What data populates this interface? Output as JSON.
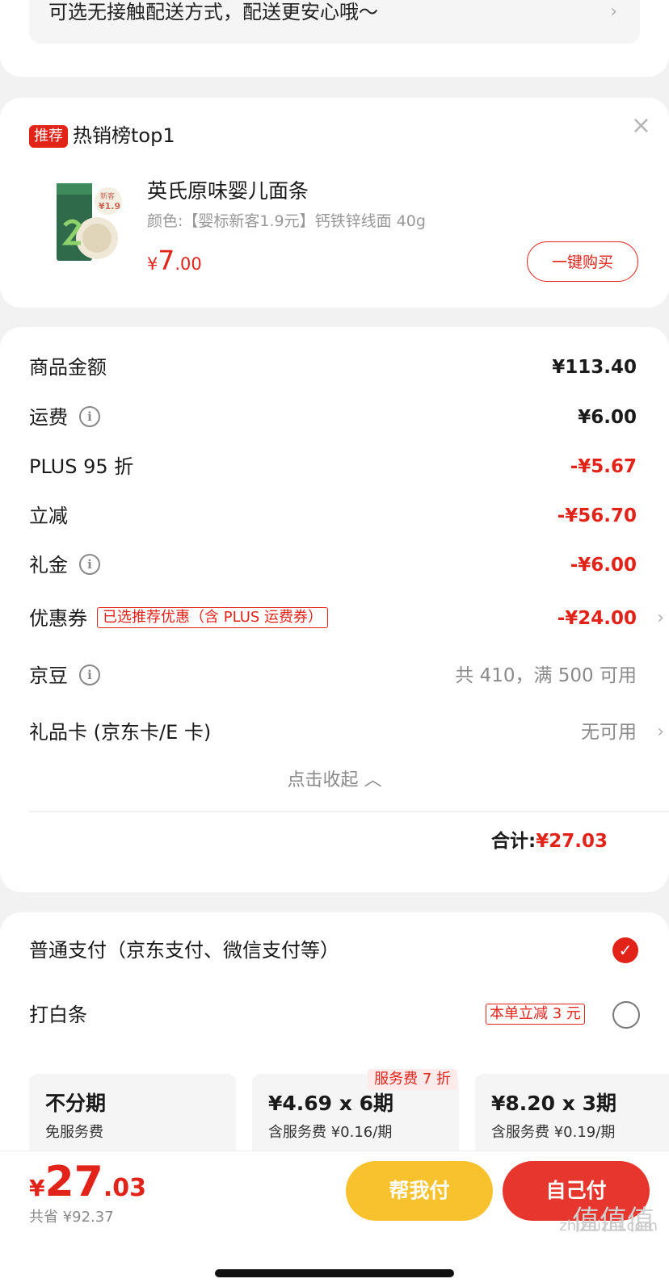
{
  "delivery": {
    "text": "可选无接触配送方式，配送更安心哦～",
    "chevron": "chevron-right"
  },
  "recommend": {
    "badge": "推荐",
    "title": "热销榜top1",
    "product": {
      "name": "英氏原味婴儿面条",
      "spec": "颜色:【婴标新客1.9元】钙铁锌线面 40g",
      "price_currency": "¥",
      "price_int": "7",
      "price_dec": ".00",
      "buy_label": "一键购买",
      "img_badge_top": "新客",
      "img_badge_price": "¥1.9"
    }
  },
  "fees": {
    "goods": {
      "label": "商品金额",
      "value": "¥113.40"
    },
    "shipping": {
      "label": "运费",
      "value": "¥6.00"
    },
    "plus": {
      "label": "PLUS 95 折",
      "value": "-¥5.67"
    },
    "discount": {
      "label": "立减",
      "value": "-¥56.70"
    },
    "gift_money": {
      "label": "礼金",
      "value": "-¥6.00"
    },
    "coupon": {
      "label": "优惠券",
      "tag": "已选推荐优惠（含 PLUS 运费券）",
      "value": "-¥24.00"
    },
    "jingdou": {
      "label": "京豆",
      "value": "共 410，满 500 可用"
    },
    "giftcard": {
      "label": "礼品卡 (京东卡/E 卡)",
      "value": "无可用"
    },
    "collapse_label": "点击收起 ︿",
    "total_label": "合计:",
    "total_value": "¥27.03"
  },
  "payment": {
    "normal_label": "普通支付（京东支付、微信支付等）",
    "baitiao_label": "打白条",
    "baitiao_promo": "本单立减 3 元",
    "plans": [
      {
        "title": "不分期",
        "sub": "免服务费"
      },
      {
        "title": "¥4.69 x 6期",
        "sub": "含服务费 ¥0.16/期",
        "tag": "服务费 7 折"
      },
      {
        "title": "¥8.20 x 3期",
        "sub": "含服务费 ¥0.19/期"
      }
    ]
  },
  "bottom": {
    "price_currency": "¥",
    "price_int": "27",
    "price_dec": ".03",
    "saved": "共省 ¥92.37",
    "help_label": "帮我付",
    "self_label": "自己付"
  },
  "watermark": {
    "logo": "值值值",
    "text": "zhizhizhi.com"
  },
  "colors": {
    "accent": "#e2231a",
    "help_button": "#f7c22e",
    "self_button": "#e6362d"
  }
}
